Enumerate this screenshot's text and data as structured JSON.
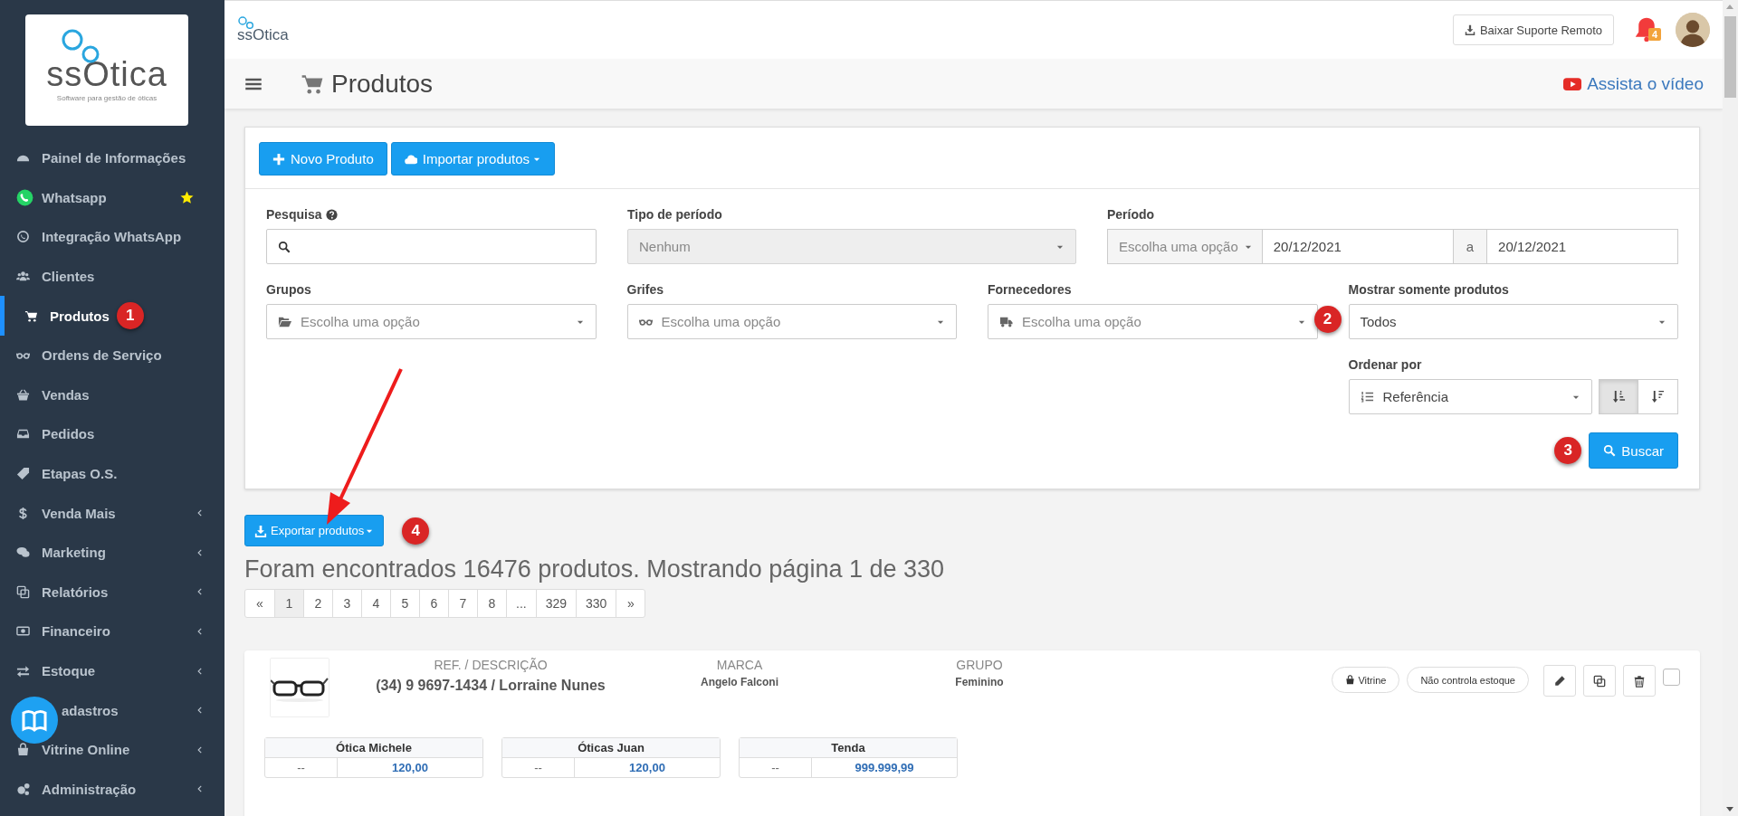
{
  "sidebar": {
    "logo": {
      "wordmark": "ssOtica",
      "tagline": "Software para gestão de óticas"
    },
    "items": [
      {
        "label": "Painel de Informações",
        "selected": false,
        "starred": false,
        "has_submenu": false
      },
      {
        "label": "Whatsapp",
        "selected": false,
        "starred": true,
        "has_submenu": false
      },
      {
        "label": "Integração WhatsApp",
        "selected": false,
        "starred": false,
        "has_submenu": false
      },
      {
        "label": "Clientes",
        "selected": false,
        "starred": false,
        "has_submenu": false
      },
      {
        "label": "Produtos",
        "selected": true,
        "starred": false,
        "has_submenu": false,
        "annotation": "1"
      },
      {
        "label": "Ordens de Serviço",
        "selected": false,
        "starred": false,
        "has_submenu": false
      },
      {
        "label": "Vendas",
        "selected": false,
        "starred": false,
        "has_submenu": false
      },
      {
        "label": "Pedidos",
        "selected": false,
        "starred": false,
        "has_submenu": false
      },
      {
        "label": "Etapas O.S.",
        "selected": false,
        "starred": false,
        "has_submenu": false
      },
      {
        "label": "Venda Mais",
        "selected": false,
        "starred": false,
        "has_submenu": true
      },
      {
        "label": "Marketing",
        "selected": false,
        "starred": false,
        "has_submenu": true
      },
      {
        "label": "Relatórios",
        "selected": false,
        "starred": false,
        "has_submenu": true
      },
      {
        "label": "Financeiro",
        "selected": false,
        "starred": false,
        "has_submenu": true
      },
      {
        "label": "Estoque",
        "selected": false,
        "starred": false,
        "has_submenu": true
      },
      {
        "label": "adastros",
        "selected": false,
        "starred": false,
        "has_submenu": true
      },
      {
        "label": "Vitrine Online",
        "selected": false,
        "starred": false,
        "has_submenu": true
      },
      {
        "label": "Administração",
        "selected": false,
        "starred": false,
        "has_submenu": true
      }
    ]
  },
  "header": {
    "logo": "ssOtica",
    "support_button": "Baixar Suporte Remoto",
    "notifications": "4"
  },
  "title_bar": {
    "title": "Produtos",
    "video_link": "Assista o vídeo"
  },
  "toolbar": {
    "buttons": [
      {
        "label": "Novo Produto",
        "dropdown": false
      },
      {
        "label": "Importar produtos",
        "dropdown": true
      }
    ]
  },
  "filters": {
    "rows": [
      [
        {
          "kind": "search",
          "label": "Pesquisa",
          "help": true
        },
        {
          "kind": "select",
          "label": "Tipo de período",
          "value": "Nenhum",
          "disabled": true
        },
        {
          "kind": "period",
          "label": "Período",
          "option": "Escolha uma opção",
          "from": "20/12/2021",
          "separator": "a",
          "to": "20/12/2021"
        }
      ],
      [
        {
          "kind": "select",
          "label": "Grupos",
          "placeholder": "Escolha uma opção",
          "disabled": false
        },
        {
          "kind": "select",
          "label": "Grifes",
          "placeholder": "Escolha uma opção",
          "disabled": false
        },
        {
          "kind": "select",
          "label": "Fornecedores",
          "placeholder": "Escolha uma opção",
          "disabled": false,
          "annotation": "2"
        },
        {
          "kind": "select",
          "label": "Mostrar somente produtos",
          "value": "Todos",
          "disabled": false
        }
      ],
      [
        "",
        "",
        "",
        {
          "kind": "sort",
          "label": "Ordenar por",
          "value": "Referência",
          "directions": [
            {
              "selected": true
            },
            {
              "selected": false
            }
          ]
        }
      ]
    ],
    "search_button": {
      "label": "Buscar",
      "annotation": "3"
    }
  },
  "export_button": {
    "label": "Exportar produtos",
    "annotation": "4"
  },
  "results_summary": "Foram encontrados 16476 produtos. Mostrando página 1 de 330",
  "pagination": [
    {
      "label": "«",
      "selected": false
    },
    {
      "label": "1",
      "selected": true
    },
    {
      "label": "2",
      "selected": false
    },
    {
      "label": "3",
      "selected": false
    },
    {
      "label": "4",
      "selected": false
    },
    {
      "label": "5",
      "selected": false
    },
    {
      "label": "6",
      "selected": false
    },
    {
      "label": "7",
      "selected": false
    },
    {
      "label": "8",
      "selected": false
    },
    {
      "label": "...",
      "selected": false
    },
    {
      "label": "329",
      "selected": false
    },
    {
      "label": "330",
      "selected": false
    },
    {
      "label": "»",
      "selected": false
    }
  ],
  "products": [
    {
      "image": {
        "kind": "picture"
      },
      "fields": [
        {
          "heading": "REF. / DESCRIÇÃO",
          "value": "(34) 9 9697-1434 / Lorraine Nunes"
        },
        {
          "heading": "MARCA",
          "value": "Angelo Falconi"
        },
        {
          "heading": "GRUPO",
          "value": "Feminino"
        }
      ],
      "tags": [
        "Vitrine",
        "Não controla estoque"
      ],
      "checked": false,
      "stores": [
        {
          "name": "Ótica Michele",
          "values": [
            "--",
            "120,00"
          ]
        },
        {
          "name": "Óticas Juan",
          "values": [
            "--",
            "120,00"
          ]
        },
        {
          "name": "Tenda",
          "values": [
            "--",
            "999.999,99"
          ]
        }
      ]
    }
  ]
}
